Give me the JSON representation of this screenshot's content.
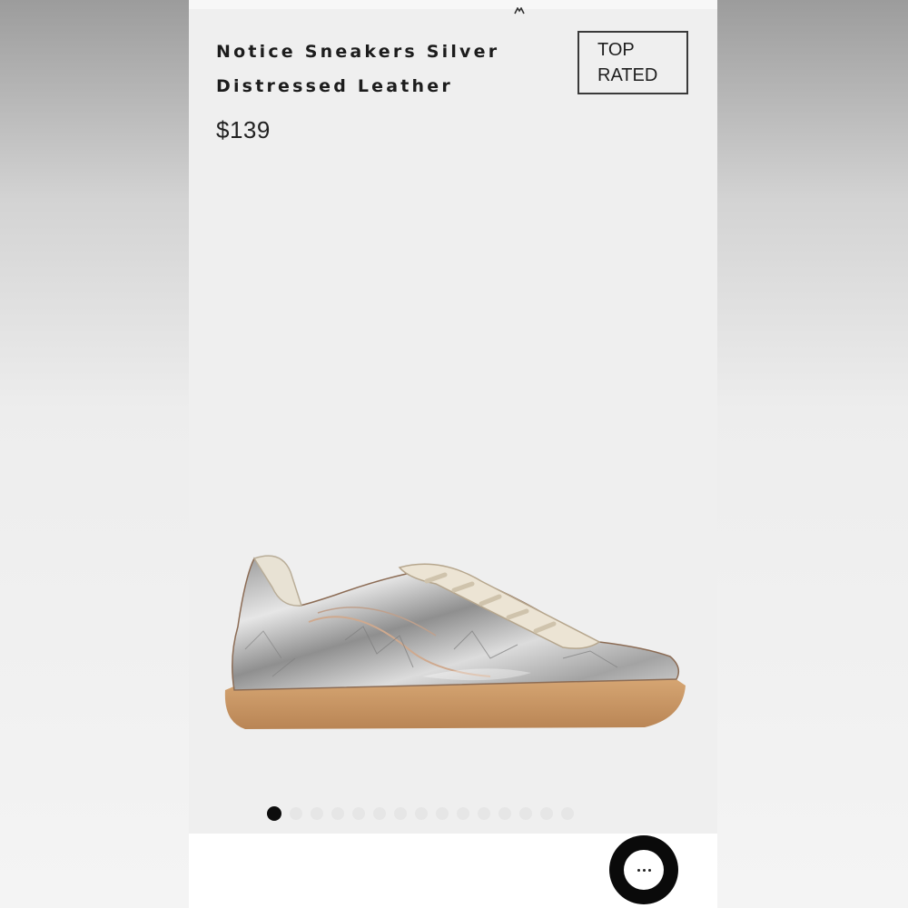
{
  "product": {
    "title_line1": "Notice Sneakers Silver",
    "title_line2": "Distressed Leather",
    "price": "$139",
    "badge_line1": "TOP",
    "badge_line2": "RATED",
    "image_alt": "Silver distressed leather low-top sneaker with gum sole",
    "image_count": 15,
    "active_image_index": 0
  },
  "chat": {
    "icon": "chat-bubble-icon"
  },
  "colors": {
    "page": "#efefef",
    "badge_border": "#3a3a3a",
    "active_dot": "#0d0d0d",
    "sole": "#c99a6a",
    "chat_button": "#0a0a0a"
  }
}
